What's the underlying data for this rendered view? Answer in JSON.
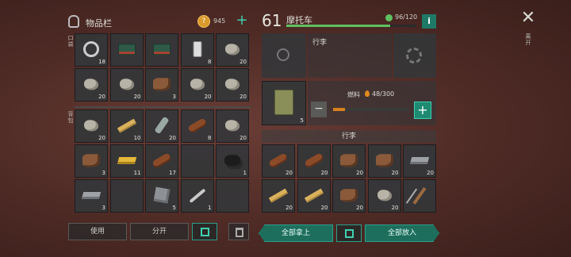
{
  "inventory": {
    "title": "物品栏",
    "coins": "945",
    "pocket_label": "口袋",
    "backpack_label": "背包",
    "pocket_slots": [
      {
        "icon": "wheel-icon",
        "count": "18"
      },
      {
        "icon": "toolbox-icon",
        "count": ""
      },
      {
        "icon": "toolbox-icon",
        "count": ""
      },
      {
        "icon": "phone-icon",
        "count": "8"
      },
      {
        "icon": "rock-icon",
        "count": "20"
      },
      {
        "icon": "rock-icon",
        "count": "20"
      },
      {
        "icon": "rock-icon",
        "count": "20"
      },
      {
        "icon": "leather-icon",
        "count": "3"
      },
      {
        "icon": "rock-icon",
        "count": "20"
      },
      {
        "icon": "rock-icon",
        "count": "20"
      }
    ],
    "backpack_slots": [
      {
        "icon": "rock-icon",
        "count": "20"
      },
      {
        "icon": "plank-icon",
        "count": "10"
      },
      {
        "icon": "bottle-icon",
        "count": "20"
      },
      {
        "icon": "log-icon",
        "count": "8"
      },
      {
        "icon": "rock-icon",
        "count": "20"
      },
      {
        "icon": "leather-icon",
        "count": "3"
      },
      {
        "icon": "gold-bar-icon",
        "count": "11"
      },
      {
        "icon": "log-icon",
        "count": "17"
      },
      {
        "icon": "empty",
        "count": ""
      },
      {
        "icon": "coal-icon",
        "count": "1"
      },
      {
        "icon": "iron-ingot-icon",
        "count": "3"
      },
      {
        "icon": "empty",
        "count": ""
      },
      {
        "icon": "metal-plate-icon",
        "count": "5"
      },
      {
        "icon": "wrench-icon",
        "count": "1"
      },
      {
        "icon": "empty",
        "count": ""
      }
    ],
    "use_label": "使用",
    "split_label": "分开"
  },
  "vehicle": {
    "level": "61",
    "name": "摩托车",
    "durability": "96/120",
    "durability_fraction": 0.8,
    "cargo_label": "行李",
    "fuel_label": "燃料",
    "fuel_value": "48/300",
    "fuel_fraction": 0.16,
    "canister_count": "5",
    "storage_title": "行李",
    "storage_slots": [
      {
        "icon": "log-icon",
        "count": "20"
      },
      {
        "icon": "log-icon",
        "count": "20"
      },
      {
        "icon": "leather-icon",
        "count": "20"
      },
      {
        "icon": "leather-icon",
        "count": "20"
      },
      {
        "icon": "iron-ingot-icon",
        "count": "20"
      },
      {
        "icon": "plank-icon",
        "count": "20"
      },
      {
        "icon": "plank-icon",
        "count": "20"
      },
      {
        "icon": "leather-icon",
        "count": "20"
      },
      {
        "icon": "rock-icon",
        "count": "20"
      },
      {
        "icon": "pickaxe-icon",
        "count": ""
      }
    ],
    "take_all_label": "全部拿上",
    "put_all_label": "全部放入"
  },
  "close": {
    "label": "离开"
  },
  "colors": {
    "accent": "#2aa08a",
    "fuel": "#d8801e"
  }
}
